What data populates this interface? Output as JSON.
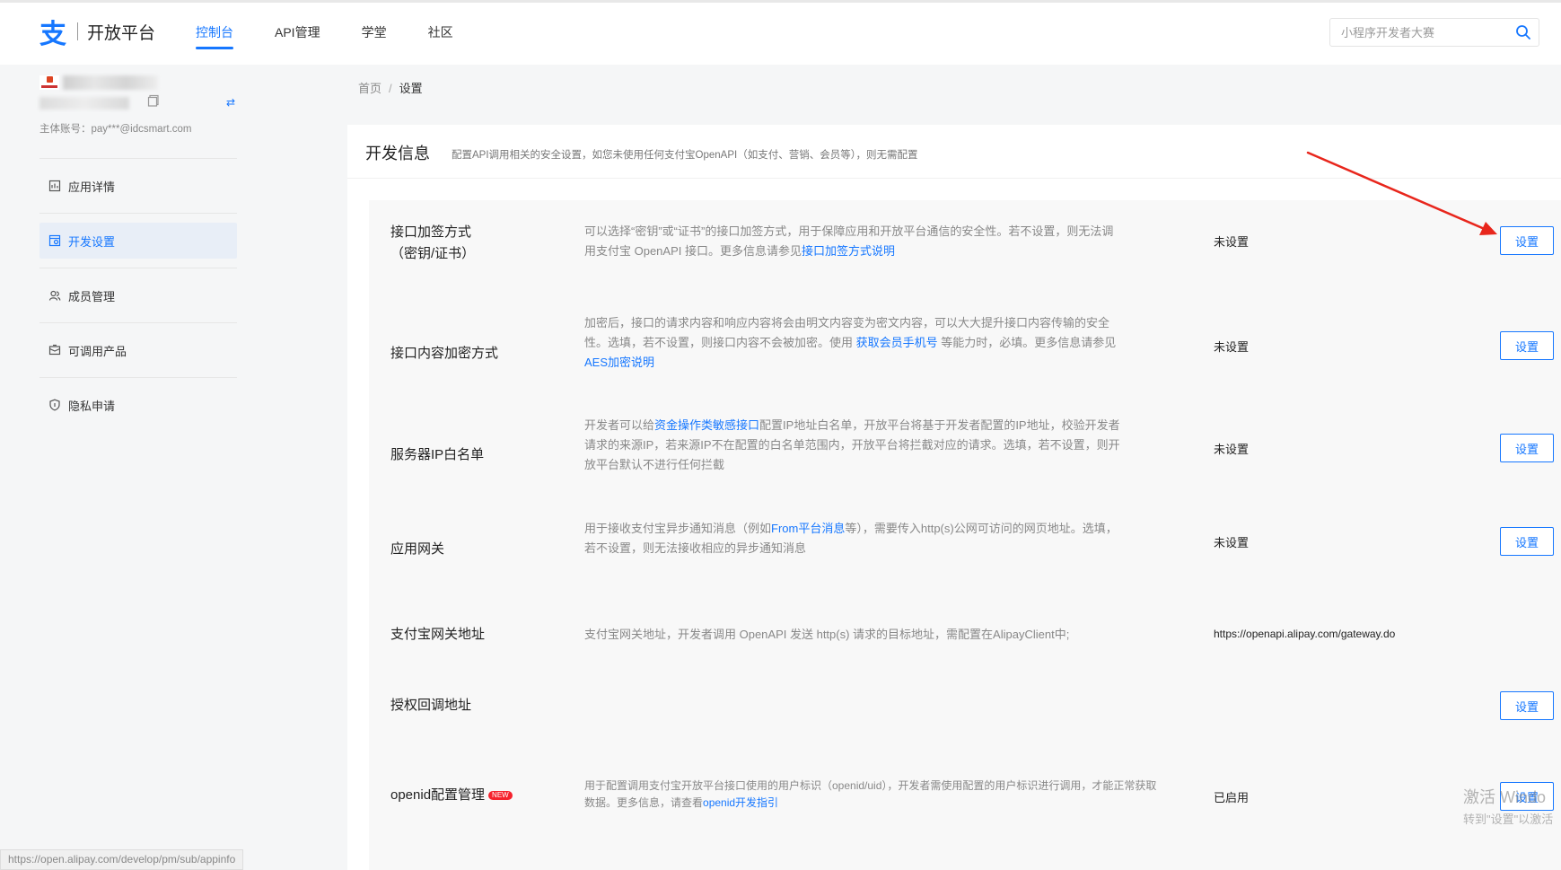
{
  "header": {
    "logo_text": "开放平台",
    "nav": [
      "控制台",
      "API管理",
      "学堂",
      "社区"
    ],
    "search_placeholder": "小程序开发者大赛"
  },
  "account": {
    "main_account": "主体账号：pay***@idcsmart.com"
  },
  "sidebar": {
    "items": [
      {
        "label": "应用详情",
        "icon": "app-detail-icon"
      },
      {
        "label": "开发设置",
        "icon": "dev-settings-icon"
      },
      {
        "label": "成员管理",
        "icon": "members-icon"
      },
      {
        "label": "可调用产品",
        "icon": "products-icon"
      },
      {
        "label": "隐私申请",
        "icon": "privacy-shield-icon"
      }
    ]
  },
  "breadcrumb": {
    "home": "首页",
    "sep": "/",
    "current": "设置"
  },
  "panel": {
    "title": "开发信息",
    "desc": "配置API调用相关的安全设置，如您未使用任何支付宝OpenAPI（如支付、营销、会员等），则无需配置"
  },
  "rows": [
    {
      "name_line1": "接口加签方式",
      "name_line2": "（密钥/证书）",
      "desc_line1": "可以选择“密钥”或“证书”的接口加签方式，用于保障应用和开放平台通信的安全性。若不设置，则无法调",
      "desc_line2_pre": "用支付宝 OpenAPI 接口。更多信息请参见",
      "desc_line2_link": "接口加签方式说明",
      "status": "未设置",
      "button": "设置"
    },
    {
      "name": "接口内容加密方式",
      "desc_line1": "加密后，接口的请求内容和响应内容将会由明文内容变为密文内容，可以大大提升接口内容传输的安全",
      "desc_line2_pre": "性。选填，若不设置，则接口内容不会被加密。使用 ",
      "desc_line2_link": "获取会员手机号",
      "desc_line2_post": " 等能力时，必填。更多信息请参见",
      "desc_line3_link": "AES加密说明",
      "status": "未设置",
      "button": "设置"
    },
    {
      "name": "服务器IP白名单",
      "desc_line1_pre": "开发者可以给",
      "desc_line1_link": "资金操作类敏感接口",
      "desc_line1_post": "配置IP地址白名单，开放平台将基于开发者配置的IP地址，校验开发者",
      "desc_line2": "请求的来源IP，若来源IP不在配置的白名单范围内，开放平台将拦截对应的请求。选填，若不设置，则开",
      "desc_line3": "放平台默认不进行任何拦截",
      "status": "未设置",
      "button": "设置"
    },
    {
      "name": "应用网关",
      "desc_line1_pre": "用于接收支付宝异步通知消息（例如",
      "desc_line1_link": "From平台消息",
      "desc_line1_post": "等），需要传入http(s)公网可访问的网页地址。选填，",
      "desc_line2": "若不设置，则无法接收相应的异步通知消息",
      "status": "未设置",
      "button": "设置"
    },
    {
      "name": "支付宝网关地址",
      "desc": "支付宝网关地址，开发者调用 OpenAPI 发送 http(s) 请求的目标地址，需配置在AlipayClient中;",
      "status": "https://openapi.alipay.com/gateway.do"
    },
    {
      "name": "授权回调地址",
      "button": "设置"
    },
    {
      "name": "openid配置管理",
      "badge": "NEW",
      "desc_line1": "用于配置调用支付宝开放平台接口使用的用户标识（openid/uid），开发者需使用配置的用户标识进行调用，才能正常获取",
      "desc_line2_pre": "数据。更多信息，请查看",
      "desc_line2_link": "openid开发指引",
      "status": "已启用",
      "button": "设置"
    }
  ],
  "status_bar_url": "https://open.alipay.com/develop/pm/sub/appinfo",
  "watermark_line1": "激活 Windo",
  "watermark_line2": "转到\"设置\"以激活",
  "colors": {
    "brand": "#1677ff",
    "arrow": "#e8261c",
    "badge": "#f5222d"
  }
}
